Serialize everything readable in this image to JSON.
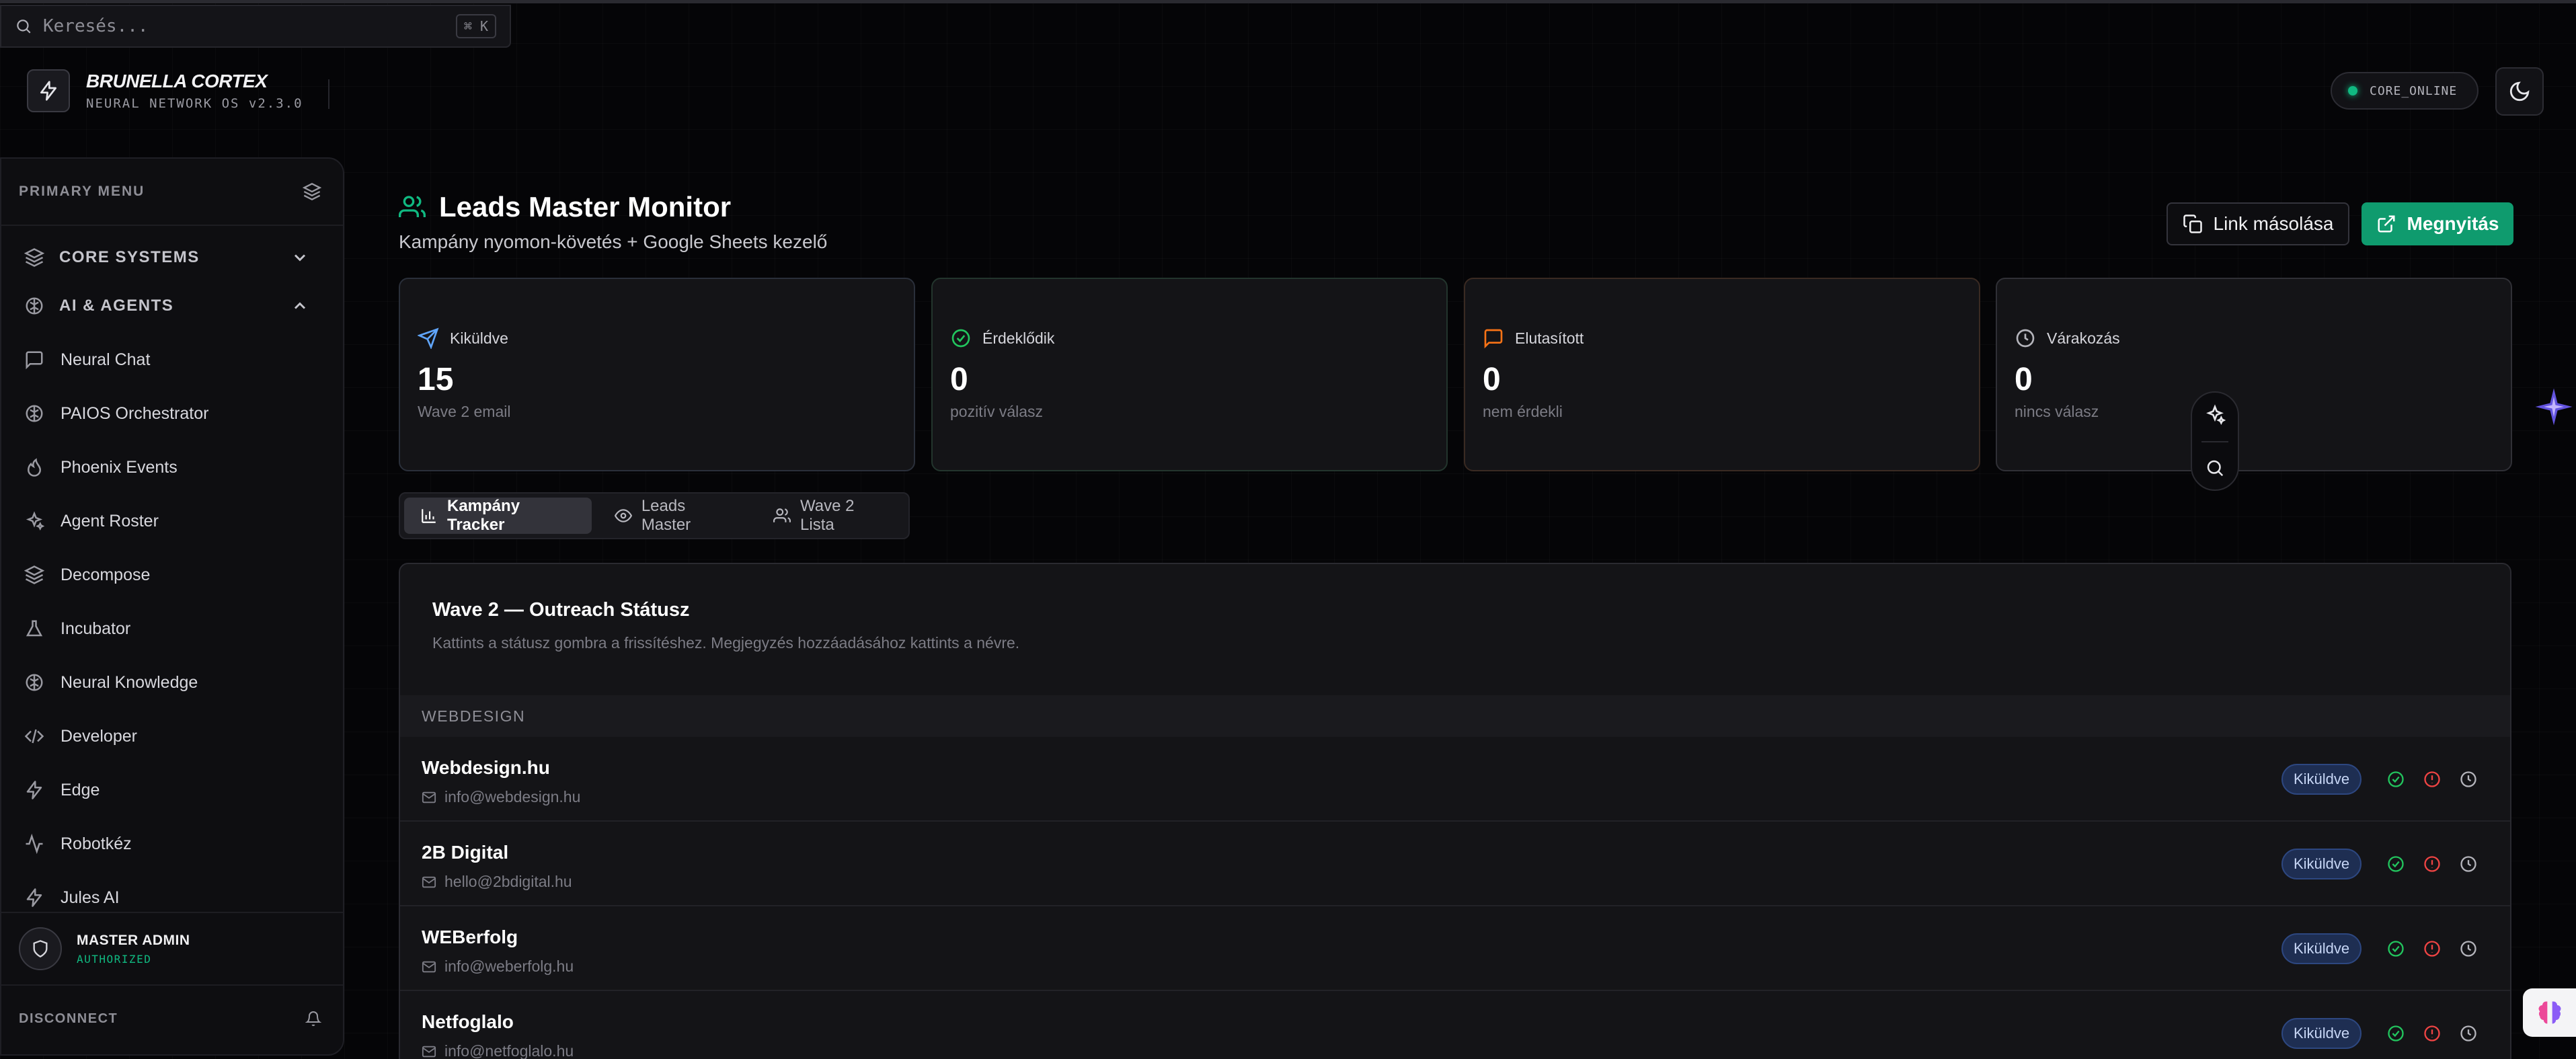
{
  "search": {
    "placeholder": "Keresés...",
    "shortcut": "⌘ K"
  },
  "brand": {
    "title": "BRUNELLA CORTEX",
    "subtitle": "NEURAL NETWORK OS v2.3.0"
  },
  "status": {
    "label": "CORE_ONLINE",
    "color": "#10b981"
  },
  "sidebar": {
    "header": "PRIMARY MENU",
    "groups": [
      {
        "label": "CORE SYSTEMS",
        "icon": "layers-icon",
        "expanded": false
      },
      {
        "label": "AI & AGENTS",
        "icon": "brain-icon",
        "expanded": true
      }
    ],
    "items": [
      {
        "label": "Neural Chat",
        "icon": "chat-icon"
      },
      {
        "label": "PAIOS Orchestrator",
        "icon": "brain-icon"
      },
      {
        "label": "Phoenix Events",
        "icon": "flame-icon"
      },
      {
        "label": "Agent Roster",
        "icon": "sparkles-icon"
      },
      {
        "label": "Decompose",
        "icon": "layers-icon"
      },
      {
        "label": "Incubator",
        "icon": "flask-icon"
      },
      {
        "label": "Neural Knowledge",
        "icon": "brain-icon"
      },
      {
        "label": "Developer",
        "icon": "code-icon"
      },
      {
        "label": "Edge",
        "icon": "zap-icon"
      },
      {
        "label": "Robotkéz",
        "icon": "activity-icon"
      },
      {
        "label": "Jules AI",
        "icon": "zap-icon"
      }
    ],
    "user": {
      "name": "MASTER ADMIN",
      "role": "AUTHORIZED"
    },
    "disconnect": "DISCONNECT"
  },
  "page": {
    "title": "Leads Master Monitor",
    "subtitle": "Kampány nyomon-követés + Google Sheets kezelő",
    "copy_button": "Link másolása",
    "open_button": "Megnyitás"
  },
  "stats": [
    {
      "label": "Kiküldve",
      "value": "15",
      "sub": "Wave 2 email",
      "icon": "send-icon",
      "accent": "#60a5fa"
    },
    {
      "label": "Érdeklődik",
      "value": "0",
      "sub": "pozitív válasz",
      "icon": "check-circle-icon",
      "accent": "#22c55e"
    },
    {
      "label": "Elutasított",
      "value": "0",
      "sub": "nem érdekli",
      "icon": "message-square-icon",
      "accent": "#f97316"
    },
    {
      "label": "Várakozás",
      "value": "0",
      "sub": "nincs válasz",
      "icon": "clock-icon",
      "accent": "#a1a1aa"
    }
  ],
  "tabs": [
    {
      "label": "Kampány Tracker",
      "icon": "bar-chart-icon",
      "active": true
    },
    {
      "label": "Leads Master",
      "icon": "eye-icon",
      "active": false
    },
    {
      "label": "Wave 2 Lista",
      "icon": "users-icon",
      "active": false
    }
  ],
  "panel": {
    "title": "Wave 2 — Outreach Státusz",
    "description": "Kattints a státusz gombra a frissítéshez. Megjegyzés hozzáadásához kattints a névre.",
    "section": "WEBDESIGN",
    "rows": [
      {
        "name": "Webdesign.hu",
        "email": "info@webdesign.hu",
        "status": "Kiküldve"
      },
      {
        "name": "2B Digital",
        "email": "hello@2bdigital.hu",
        "status": "Kiküldve"
      },
      {
        "name": "WEBerfolg",
        "email": "info@weberfolg.hu",
        "status": "Kiküldve"
      },
      {
        "name": "Netfoglalo",
        "email": "info@netfoglalo.hu",
        "status": "Kiküldve"
      }
    ]
  }
}
